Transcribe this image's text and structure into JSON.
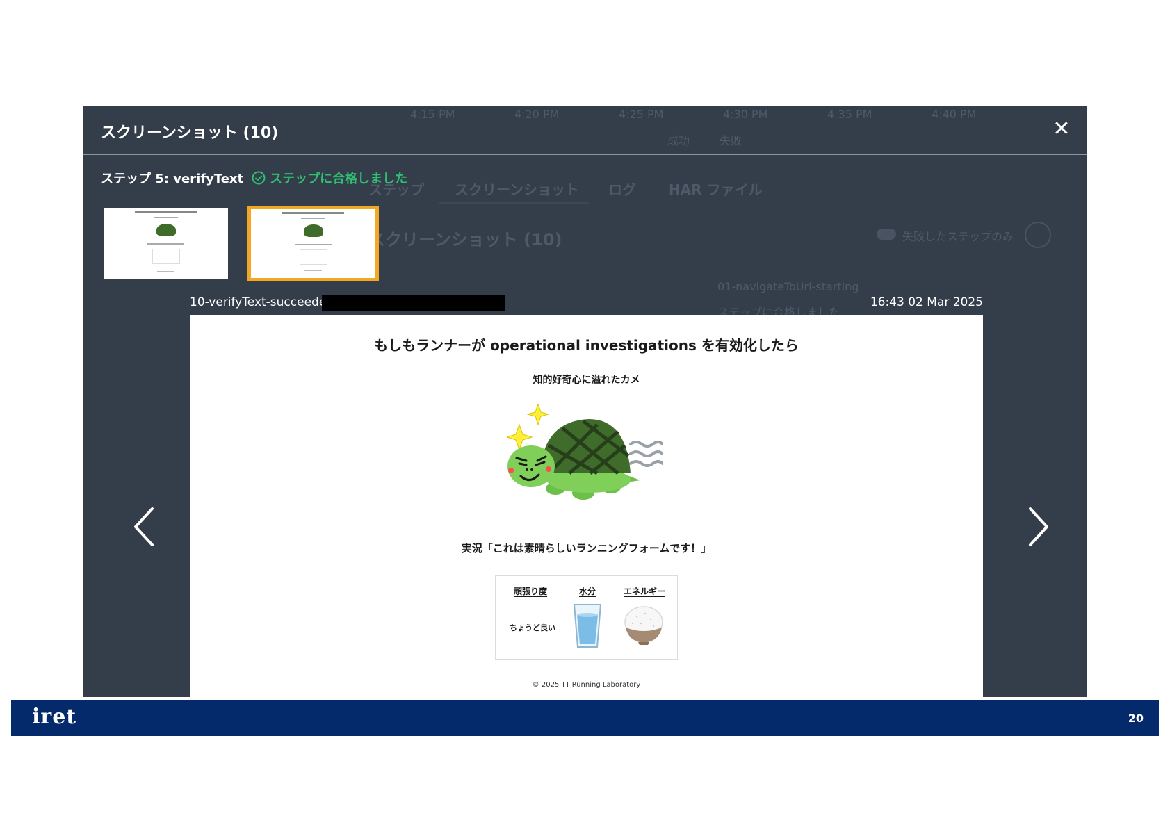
{
  "modal": {
    "title": "スクリーンショット (10)",
    "close_icon": "close-icon",
    "step_label": "ステップ 5: verifyText",
    "step_status": "ステップに合格しました",
    "status_color": "#2fbf71",
    "selected_thumb_border": "#f2a823"
  },
  "background": {
    "times": [
      "4:15 PM",
      "4:20 PM",
      "4:25 PM",
      "4:30 PM",
      "4:35 PM",
      "4:40 PM"
    ],
    "legend_success": "成功",
    "legend_fail": "失敗",
    "tabs": [
      "ステップ",
      "スクリーンショット",
      "ログ",
      "HAR ファイル"
    ],
    "section_title": "スクリーンショット (10)",
    "failed_only": "失敗したステップのみ",
    "list_item": "01-navigateToUrl-starting",
    "list_status": "ステップに合格しました"
  },
  "screenshot": {
    "name": "10-verifyText-succeeded",
    "time": "16:43 02 Mar 2025"
  },
  "page": {
    "title": "もしもランナーが operational investigations を有効化したら",
    "subtitle": "知的好奇心に溢れたカメ",
    "commentary": "実況「これは素晴らしいランニングフォームです！」",
    "stats": {
      "effort_label": "頑張り度",
      "water_label": "水分",
      "energy_label": "エネルギー",
      "effort_value": "ちょうど良い"
    },
    "copyright": "© 2025 TT Running Laboratory"
  },
  "footer": {
    "logo": "iret",
    "page_number": "20",
    "color": "#042a6b"
  }
}
